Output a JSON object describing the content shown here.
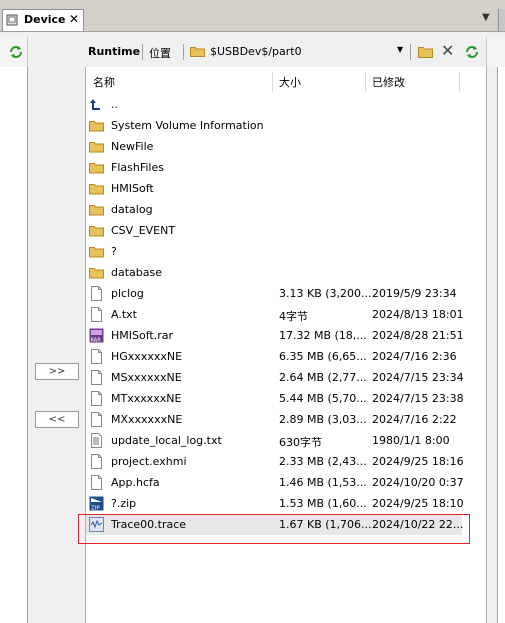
{
  "tab": {
    "label": "Device",
    "close": "✕"
  },
  "toolbar": {
    "runtime": "Runtime",
    "location": "位置",
    "path": "$USBDev$/part0",
    "dropdown": "▼",
    "close": "✕"
  },
  "nav": {
    "forward": ">>",
    "back": "<<"
  },
  "columns": {
    "name": "名称",
    "size": "大小",
    "modified": "已修改"
  },
  "files": [
    {
      "name": "..",
      "size": "",
      "modified": "",
      "icon": "up-arrow"
    },
    {
      "name": "System Volume Information",
      "size": "",
      "modified": "",
      "icon": "folder"
    },
    {
      "name": "NewFile",
      "size": "",
      "modified": "",
      "icon": "folder"
    },
    {
      "name": "FlashFiles",
      "size": "",
      "modified": "",
      "icon": "folder"
    },
    {
      "name": "HMISoft",
      "size": "",
      "modified": "",
      "icon": "folder"
    },
    {
      "name": "datalog",
      "size": "",
      "modified": "",
      "icon": "folder"
    },
    {
      "name": "CSV_EVENT",
      "size": "",
      "modified": "",
      "icon": "folder"
    },
    {
      "name": "?",
      "size": "",
      "modified": "",
      "icon": "folder"
    },
    {
      "name": "database",
      "size": "",
      "modified": "",
      "icon": "folder"
    },
    {
      "name": "plclog",
      "size": "3.13 KB (3,200...",
      "modified": "2019/5/9 23:34",
      "icon": "file"
    },
    {
      "name": "A.txt",
      "size": "4字节",
      "modified": "2024/8/13 18:01",
      "icon": "file"
    },
    {
      "name": "HMISoft.rar",
      "size": "17.32 MB (18,...",
      "modified": "2024/8/28 21:51",
      "icon": "rar"
    },
    {
      "name": "HGxxxxxxNE",
      "size": "6.35 MB (6,65...",
      "modified": "2024/7/16 2:36",
      "icon": "file"
    },
    {
      "name": "MSxxxxxxNE",
      "size": "2.64 MB (2,77...",
      "modified": "2024/7/15 23:34",
      "icon": "file"
    },
    {
      "name": "MTxxxxxxNE",
      "size": "5.44 MB (5,70...",
      "modified": "2024/7/15 23:38",
      "icon": "file"
    },
    {
      "name": "MXxxxxxxNE",
      "size": "2.89 MB (3,03...",
      "modified": "2024/7/16 2:22",
      "icon": "file"
    },
    {
      "name": "update_local_log.txt",
      "size": "630字节",
      "modified": "1980/1/1 8:00",
      "icon": "textfile"
    },
    {
      "name": "project.exhmi",
      "size": "2.33 MB (2,43...",
      "modified": "2024/9/25 18:16",
      "icon": "file"
    },
    {
      "name": "App.hcfa",
      "size": "1.46 MB (1,53...",
      "modified": "2024/10/20 0:37",
      "icon": "file"
    },
    {
      "name": "?.zip",
      "size": "1.53 MB (1,60...",
      "modified": "2024/9/25 18:10",
      "icon": "zip"
    },
    {
      "name": "Trace00.trace",
      "size": "1.67 KB (1,706...",
      "modified": "2024/10/22 22...",
      "icon": "trace"
    }
  ]
}
